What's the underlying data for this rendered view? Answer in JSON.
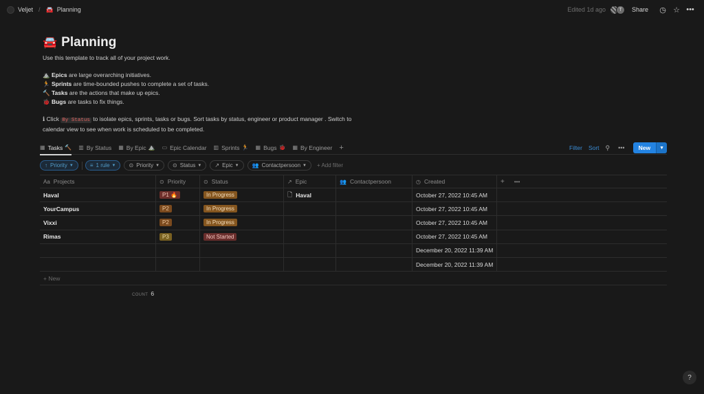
{
  "topbar": {
    "workspace": "Veljet",
    "separator": "/",
    "page_icon": "🚘",
    "page": "Planning",
    "edited": "Edited 1d ago",
    "avatar_initial": "T",
    "share": "Share",
    "icons": [
      "clock-icon",
      "star-icon",
      "more-icon"
    ]
  },
  "header": {
    "emoji": "🚘",
    "title": "Planning"
  },
  "description": {
    "intro": "Use this template to track all of your project work.",
    "items": [
      {
        "emoji": "⛰️",
        "bold": "Epics",
        "text": " are large overarching initiatives."
      },
      {
        "emoji": "🏃",
        "bold": "Sprints",
        "text": " are time-bounded pushes to complete a set of tasks."
      },
      {
        "emoji": "🔨",
        "bold": "Tasks",
        "text": " are the actions that make up epics."
      },
      {
        "emoji": "🐞",
        "bold": "Bugs",
        "text": " are tasks to fix things."
      }
    ],
    "info_icon": "ℹ",
    "click": " Click ",
    "code": "By Status",
    "rest1": " to isolate epics, sprints, tasks or bugs. Sort tasks by status, engineer or product manager . Switch to",
    "rest2": "calendar view to see when work is scheduled to be completed."
  },
  "tabs": [
    {
      "label": "Tasks",
      "extra": "🔨",
      "active": true
    },
    {
      "label": "By Status",
      "extra": ""
    },
    {
      "label": "By Epic",
      "extra": "⛰️"
    },
    {
      "label": "Epic Calendar",
      "extra": ""
    },
    {
      "label": "Sprints",
      "extra": "🏃"
    },
    {
      "label": "Bugs",
      "extra": "🐞"
    },
    {
      "label": "By Engineer",
      "extra": ""
    }
  ],
  "toolbar": {
    "filter": "Filter",
    "sort": "Sort",
    "new": "New"
  },
  "filters": {
    "sort_priority": "Priority",
    "rule": "1 rule",
    "priority": "Priority",
    "status": "Status",
    "epic": "Epic",
    "contact": "Contactpersoon",
    "add": "Add filter"
  },
  "columns": {
    "projects": "Projects",
    "priority": "Priority",
    "status": "Status",
    "epic": "Epic",
    "contact": "Contactpersoon",
    "created": "Created"
  },
  "rows": [
    {
      "name": "Haval",
      "priority": "P1 🔥",
      "pclass": "p1",
      "status": "In Progress",
      "sclass": "prog",
      "epic": "Haval",
      "created": "October 27, 2022 10:45 AM"
    },
    {
      "name": "YourCampus",
      "priority": "P2",
      "pclass": "p2",
      "status": "In Progress",
      "sclass": "prog",
      "epic": "",
      "created": "October 27, 2022 10:45 AM"
    },
    {
      "name": "Vixxi",
      "priority": "P2",
      "pclass": "p2",
      "status": "In Progress",
      "sclass": "prog",
      "epic": "",
      "created": "October 27, 2022 10:45 AM"
    },
    {
      "name": "Rimas",
      "priority": "P3",
      "pclass": "p3",
      "status": "Not Started",
      "sclass": "notst",
      "epic": "",
      "created": "October 27, 2022 10:45 AM"
    },
    {
      "name": "",
      "priority": "",
      "pclass": "",
      "status": "",
      "sclass": "",
      "epic": "",
      "created": "December 20, 2022 11:39 AM"
    },
    {
      "name": "",
      "priority": "",
      "pclass": "",
      "status": "",
      "sclass": "",
      "epic": "",
      "created": "December 20, 2022 11:39 AM"
    }
  ],
  "table_footer": {
    "new_row": "+ New",
    "count_label": "COUNT",
    "count": "6"
  },
  "help": "?",
  "colors": {
    "accent": "#2383e2",
    "background": "#191919"
  }
}
